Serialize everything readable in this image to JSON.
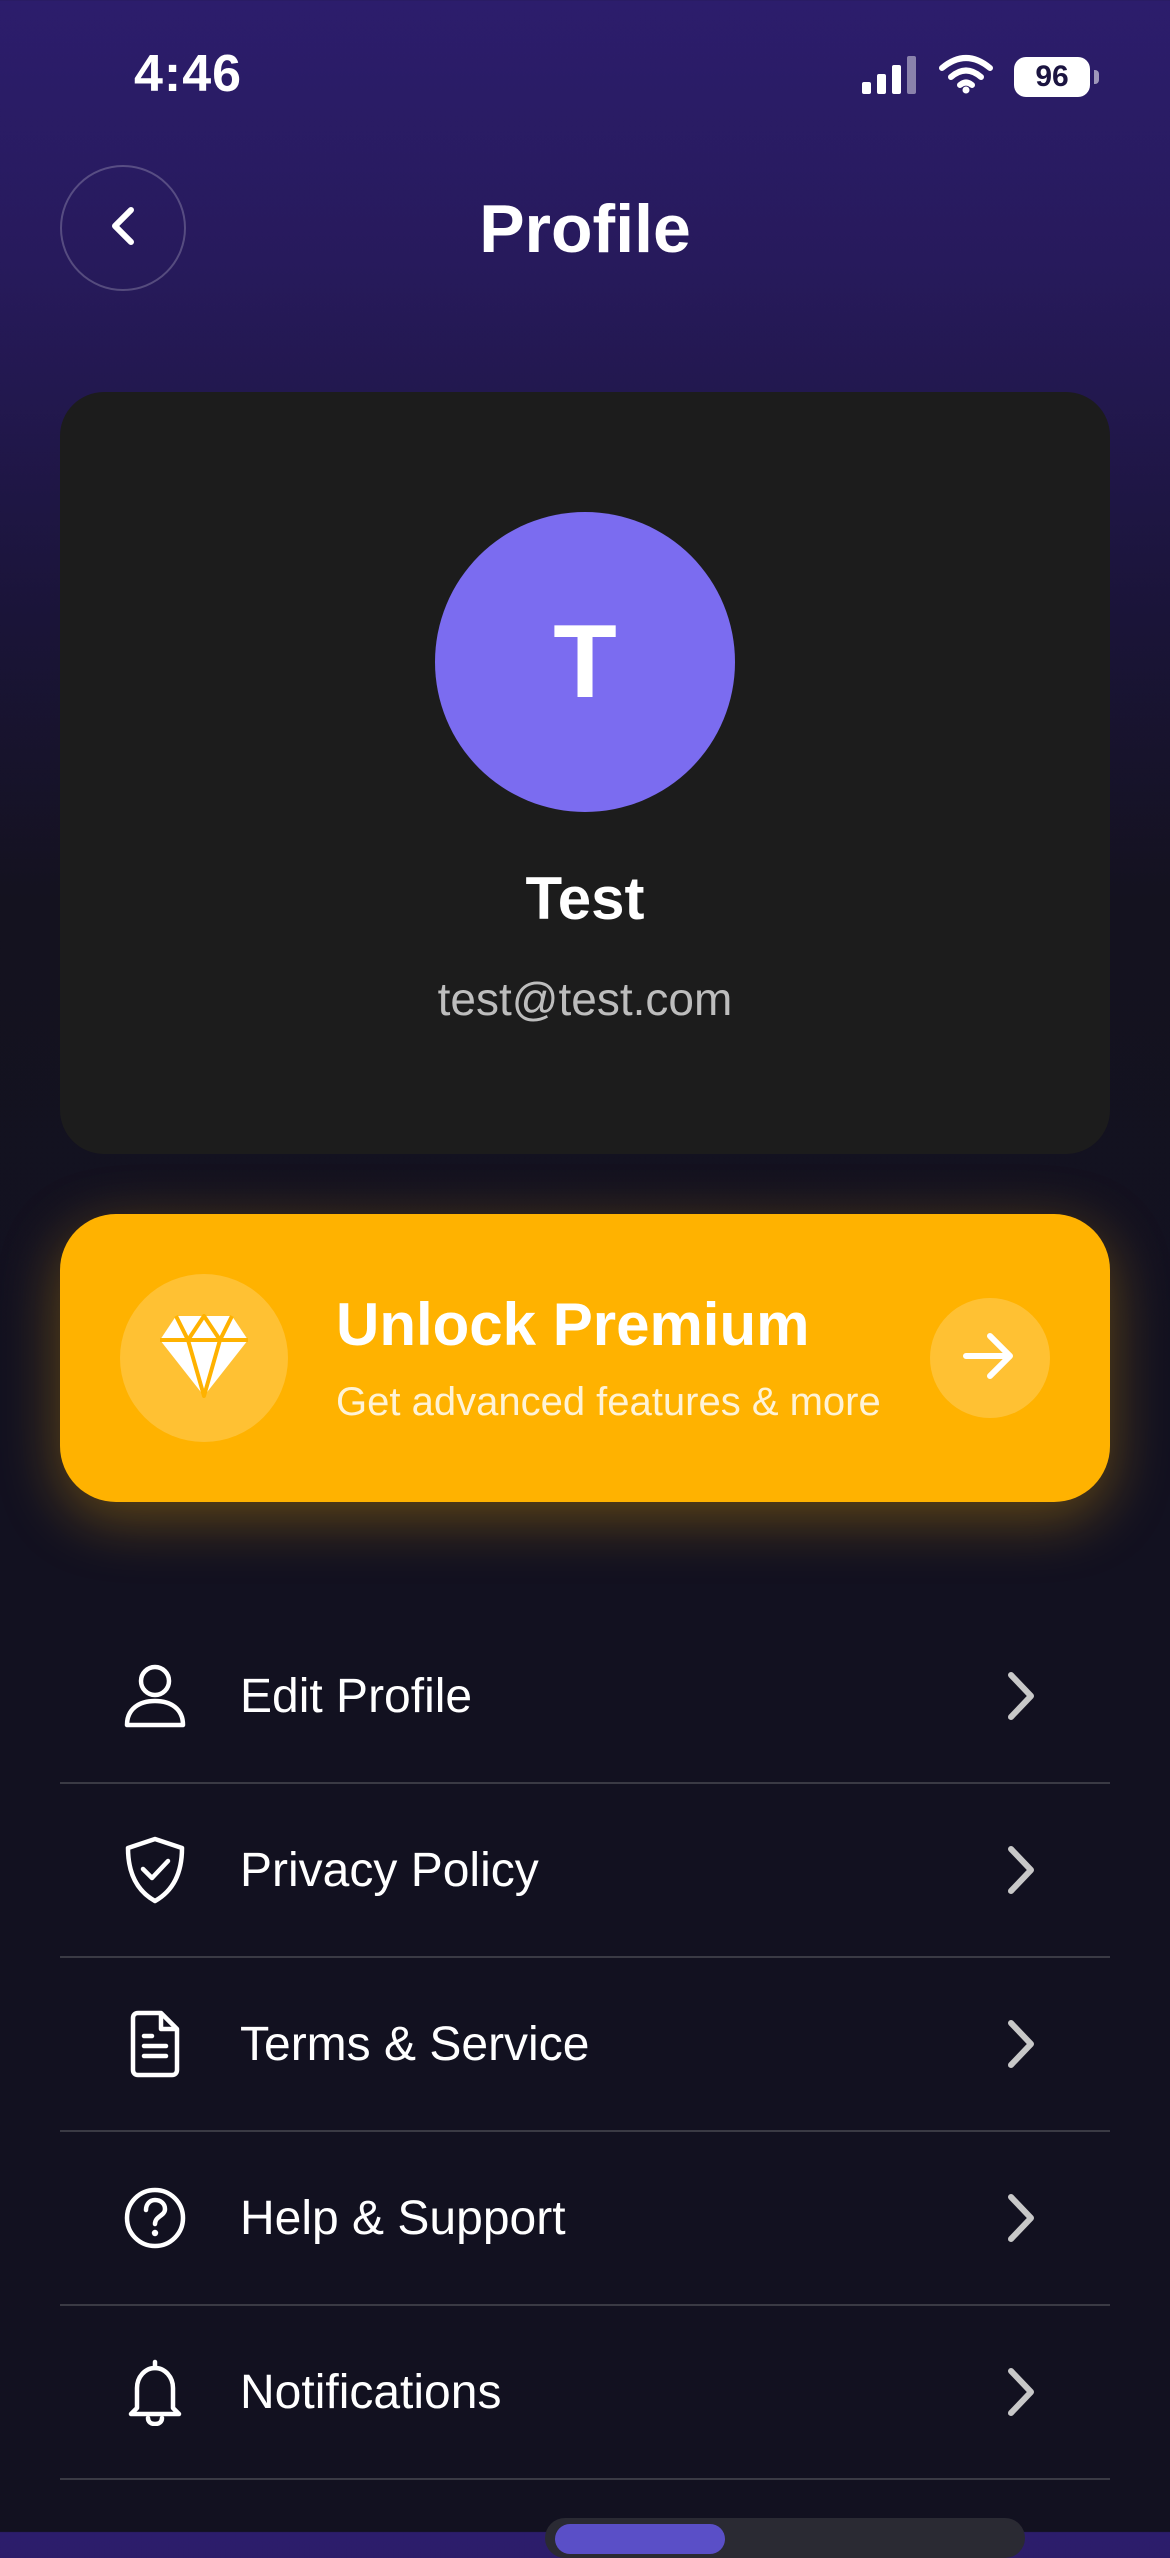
{
  "status_bar": {
    "time": "4:46",
    "battery": "96",
    "icons": [
      "cellular-signal-icon",
      "wifi-icon",
      "battery-icon"
    ]
  },
  "header": {
    "title": "Profile",
    "back_icon": "chevron-left-icon"
  },
  "profile": {
    "initial": "T",
    "name": "Test",
    "email": "test@test.com",
    "avatar_color": "#7b6cf0"
  },
  "premium": {
    "title": "Unlock Premium",
    "subtitle": "Get advanced features & more",
    "icon": "diamond-icon",
    "action_icon": "arrow-right-icon",
    "color": "#ffb200"
  },
  "menu": {
    "items": [
      {
        "label": "Edit Profile",
        "icon": "user-icon"
      },
      {
        "label": "Privacy Policy",
        "icon": "shield-check-icon"
      },
      {
        "label": "Terms & Service",
        "icon": "document-icon"
      },
      {
        "label": "Help & Support",
        "icon": "help-circle-icon"
      },
      {
        "label": "Notifications",
        "icon": "bell-icon"
      }
    ]
  },
  "colors": {
    "background_top": "#2c1d6c",
    "background_bottom": "#121120",
    "card": "#1c1c1c",
    "divider": "#3a3a44"
  }
}
